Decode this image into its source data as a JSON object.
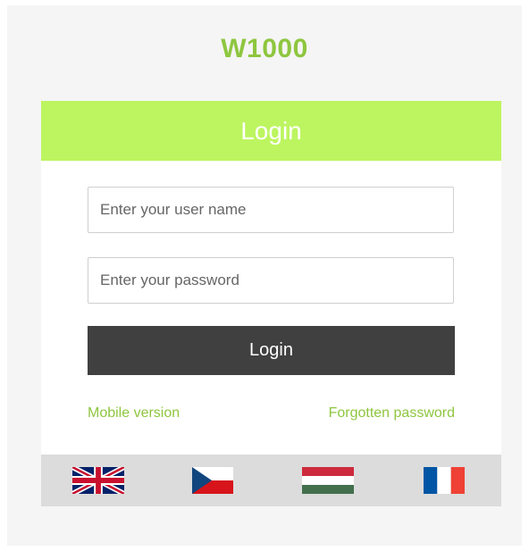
{
  "brand": {
    "title": "W1000"
  },
  "login_card": {
    "header_title": "Login",
    "username": {
      "placeholder": "Enter your user name",
      "value": ""
    },
    "password": {
      "placeholder": "Enter your password",
      "value": ""
    },
    "login_button_label": "Login",
    "mobile_link_label": "Mobile version",
    "forgot_link_label": "Forgotten password"
  },
  "languages": [
    {
      "code": "en",
      "icon": "flag-uk-icon"
    },
    {
      "code": "cs",
      "icon": "flag-cz-icon"
    },
    {
      "code": "hu",
      "icon": "flag-hu-icon"
    },
    {
      "code": "fr",
      "icon": "flag-fr-icon"
    }
  ],
  "colors": {
    "accent_green": "#8ec63f",
    "header_green": "#bdf560",
    "button_dark": "#404040",
    "flag_bar": "#dcdcdc"
  }
}
